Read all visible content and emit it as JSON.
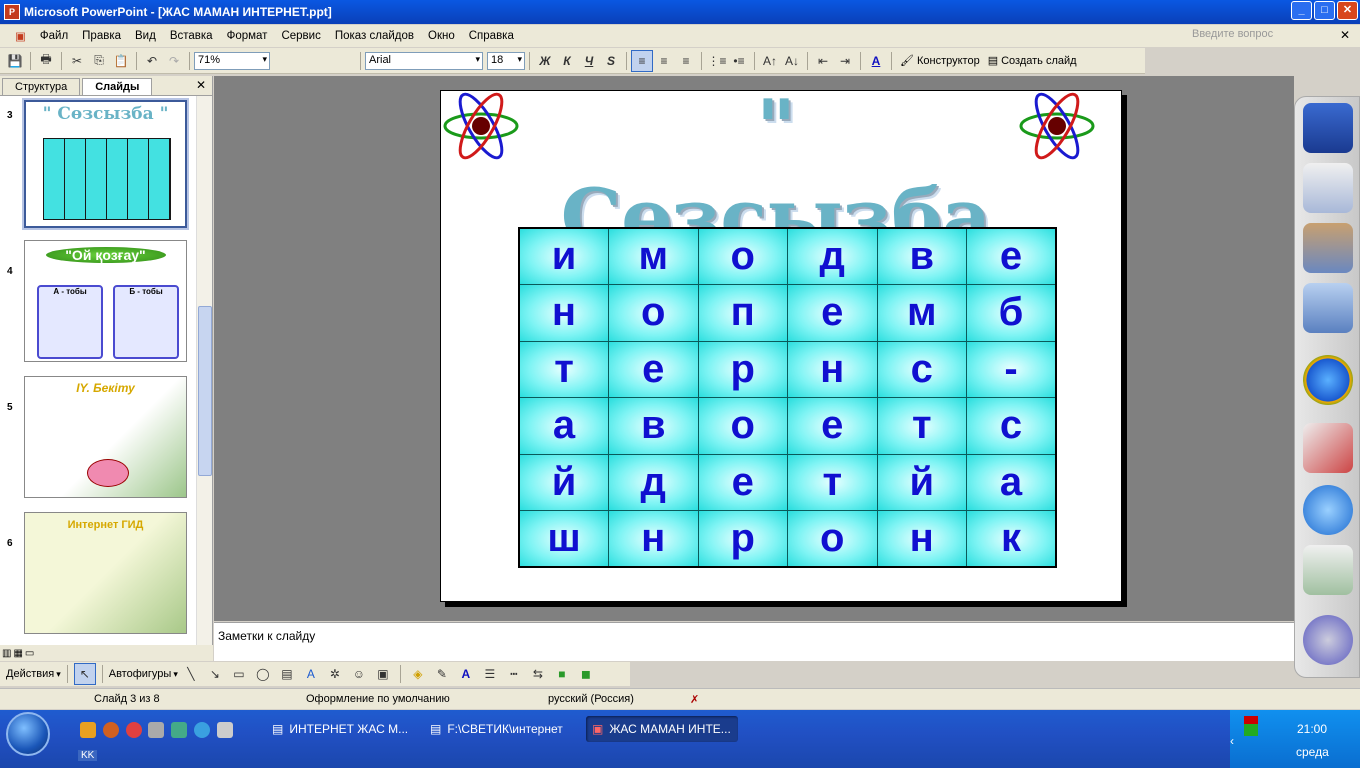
{
  "window": {
    "title": "Microsoft PowerPoint - [ЖАС МАМАН ИНТЕРНЕТ.ppt]"
  },
  "menu": {
    "items": [
      "Файл",
      "Правка",
      "Вид",
      "Вставка",
      "Формат",
      "Сервис",
      "Показ слайдов",
      "Окно",
      "Справка"
    ],
    "ask_placeholder": "Введите вопрос"
  },
  "toolbar": {
    "zoom": "71%",
    "font": "Arial",
    "size": "18",
    "bold": "Ж",
    "italic": "К",
    "underline": "Ч",
    "shadow": "S",
    "designer": "Конструктор",
    "new_slide": "Создать слайд"
  },
  "left_panel": {
    "tab_outline": "Структура",
    "tab_slides": "Слайды",
    "slides": [
      {
        "num": "3",
        "title": "\" Сөзсызба \""
      },
      {
        "num": "4",
        "title": "\"Ой қозғау\"",
        "group_a": "А - тобы",
        "group_b": "Б - тобы"
      },
      {
        "num": "5",
        "title": "IY. Бекіту"
      },
      {
        "num": "6",
        "title": "Интернет ГИД"
      }
    ]
  },
  "slide": {
    "title": "\" Сөзсызба \"",
    "grid": [
      [
        "и",
        "м",
        "о",
        "д",
        "в",
        "е"
      ],
      [
        "н",
        "о",
        "п",
        "е",
        "м",
        "б"
      ],
      [
        "т",
        "е",
        "р",
        "н",
        "с",
        "-"
      ],
      [
        "а",
        "в",
        "о",
        "е",
        "т",
        "с"
      ],
      [
        "й",
        "д",
        "е",
        "т",
        "й",
        "а"
      ],
      [
        "ш",
        "н",
        "р",
        "о",
        "н",
        "к"
      ]
    ]
  },
  "notes": {
    "placeholder": "Заметки к слайду"
  },
  "drawing": {
    "actions": "Действия",
    "autoshapes": "Автофигуры"
  },
  "status": {
    "slide": "Слайд 3 из 8",
    "design": "Оформление по умолчанию",
    "lang": "русский (Россия)"
  },
  "taskbar": {
    "tasks": [
      "ИНТЕРНЕТ ЖАС М...",
      "F:\\СВЕТИК\\интернет",
      "ЖАС МАМАН ИНТЕ..."
    ],
    "lang": "KK",
    "time": "21:00",
    "day": "среда"
  }
}
